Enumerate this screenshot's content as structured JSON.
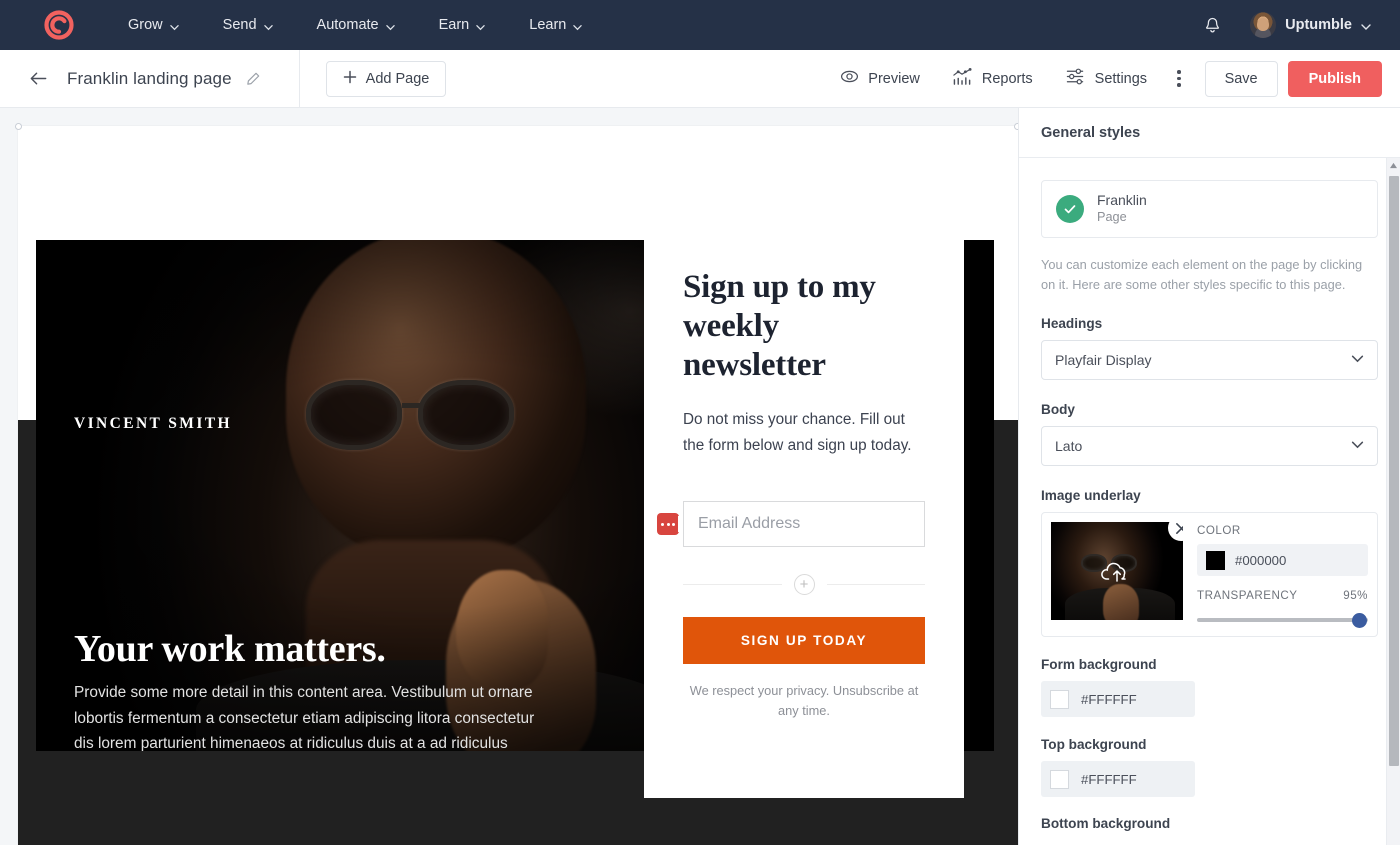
{
  "brand": {
    "accent_publish": "#f05f5f",
    "accent_logo": "#f1625f",
    "nav_bg": "#253147"
  },
  "topnav": {
    "logo_icon": "convertkit-logo-icon",
    "links": [
      {
        "label": "Grow"
      },
      {
        "label": "Send"
      },
      {
        "label": "Automate"
      },
      {
        "label": "Earn"
      },
      {
        "label": "Learn"
      }
    ],
    "notifications_icon": "bell-icon",
    "account": {
      "name": "Uptumble",
      "avatar": "user-avatar",
      "caret": "chevron-down-icon"
    }
  },
  "toolbar": {
    "back_icon": "arrow-left-icon",
    "page_title": "Franklin landing page",
    "edit_icon": "pencil-icon",
    "add_page_label": "Add Page",
    "add_page_icon": "plus-icon",
    "preview_label": "Preview",
    "preview_icon": "eye-icon",
    "reports_label": "Reports",
    "reports_icon": "bar-chart-icon",
    "settings_label": "Settings",
    "settings_icon": "sliders-icon",
    "more_icon": "kebab-menu-icon",
    "save_label": "Save",
    "publish_label": "Publish"
  },
  "canvas": {
    "hero": {
      "eyebrow": "VINCENT SMITH",
      "heading": "Your work matters.",
      "paragraph": "Provide some more detail in this content area. Vestibulum ut ornare lobortis fermentum a consectetur etiam adipiscing litora consectetur dis lorem parturient himenaeos at ridiculus duis at a ad ridiculus parturient ipsum enim lorem scelerisque."
    },
    "form": {
      "heading": "Sign up to my weekly newsletter",
      "subtext": "Do not miss your chance. Fill out the form below and sign up today.",
      "email_placeholder": "Email Address",
      "email_value": "",
      "dots_handle_icon": "more-options-handle-icon",
      "add_field_icon": "plus-circle-icon",
      "submit_label": "SIGN UP TODAY",
      "submit_color": "#e0550a",
      "privacy_note": "We respect your privacy. Unsubscribe at any time."
    }
  },
  "panel": {
    "title": "General styles",
    "selected_element": {
      "status_icon": "check-circle-icon",
      "name": "Franklin",
      "type": "Page"
    },
    "note": "You can customize each element on the page by clicking on it. Here are some other styles specific to this page.",
    "headings": {
      "label": "Headings",
      "value": "Playfair Display",
      "caret": "chevron-down-icon"
    },
    "body": {
      "label": "Body",
      "value": "Lato",
      "caret": "chevron-down-icon"
    },
    "image_underlay": {
      "label": "Image underlay",
      "thumbnail": "portrait-thumbnail",
      "remove_icon": "close-x-icon",
      "upload_icon": "cloud-upload-icon",
      "color_label": "COLOR",
      "color_value": "#000000",
      "transparency_label": "TRANSPARENCY",
      "transparency_value": "95%"
    },
    "form_background": {
      "label": "Form background",
      "value": "#FFFFFF"
    },
    "top_background": {
      "label": "Top background",
      "value": "#FFFFFF"
    },
    "bottom_background": {
      "label": "Bottom background"
    },
    "scrollbar": {
      "up_icon": "scroll-up-arrow-icon"
    }
  }
}
